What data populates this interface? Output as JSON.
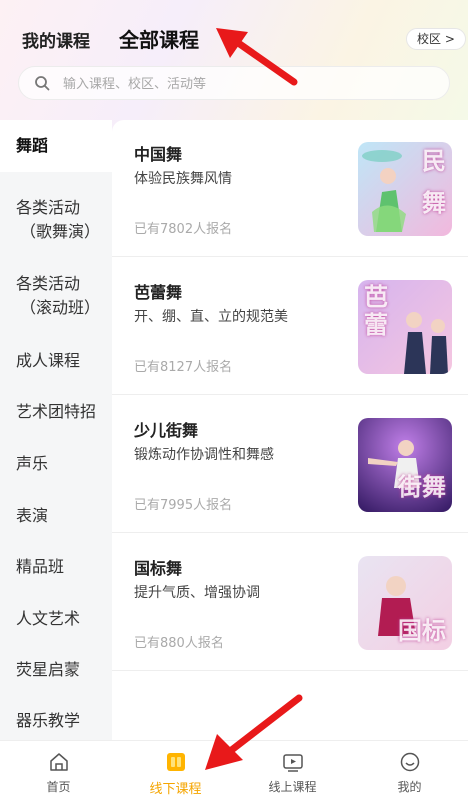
{
  "header": {
    "tab_my": "我的课程",
    "tab_all": "全部课程",
    "campus": "校区 >"
  },
  "search": {
    "placeholder": "输入课程、校区、活动等"
  },
  "sidebar": {
    "items": [
      {
        "label": "舞蹈",
        "active": true
      },
      {
        "label": "各类活动",
        "sub": "（歌舞演）"
      },
      {
        "label": "各类活动",
        "sub": "（滚动班）"
      },
      {
        "label": "成人课程"
      },
      {
        "label": "艺术团特招"
      },
      {
        "label": "声乐"
      },
      {
        "label": "表演"
      },
      {
        "label": "精品班"
      },
      {
        "label": "人文艺术"
      },
      {
        "label": "荧星启蒙"
      },
      {
        "label": "器乐教学"
      }
    ]
  },
  "courses": [
    {
      "title": "中国舞",
      "desc": "体验民族舞风情",
      "count": "已有7802人报名",
      "thumb_text": [
        "民",
        "舞"
      ]
    },
    {
      "title": "芭蕾舞",
      "desc": "开、绷、直、立的规范美",
      "count": "已有8127人报名",
      "thumb_text": [
        "芭",
        "蕾"
      ]
    },
    {
      "title": "少儿街舞",
      "desc": "锻炼动作协调性和舞感",
      "count": "已有7995人报名",
      "thumb_text": [
        "街舞"
      ]
    },
    {
      "title": "国标舞",
      "desc": "提升气质、增强协调",
      "count": "已有880人报名",
      "thumb_text": [
        "国标"
      ]
    }
  ],
  "bottom_nav": [
    {
      "label": "首页",
      "icon": "home-icon"
    },
    {
      "label": "线下课程",
      "icon": "offline-course-icon",
      "active": true
    },
    {
      "label": "线上课程",
      "icon": "video-icon"
    },
    {
      "label": "我的",
      "icon": "profile-icon"
    }
  ],
  "colors": {
    "accent": "#ffcc00",
    "active_nav": "#f5a500",
    "annotation_arrow": "#e8191a"
  }
}
